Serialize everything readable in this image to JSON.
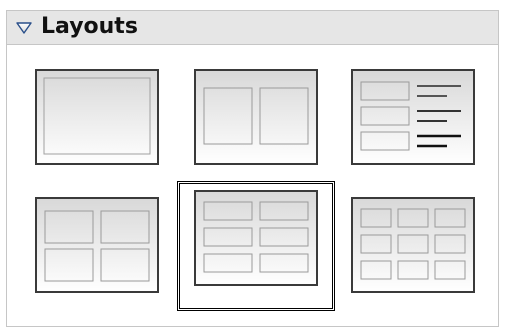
{
  "panel": {
    "title": "Layouts",
    "expanded": true,
    "toggle_icon": "triangle-down-icon"
  },
  "layouts": [
    {
      "id": "blank",
      "icon": "layout-blank-icon",
      "selected": false
    },
    {
      "id": "two-columns",
      "icon": "layout-two-columns-icon",
      "selected": false
    },
    {
      "id": "boxes-and-text",
      "icon": "layout-boxes-text-icon",
      "selected": false
    },
    {
      "id": "four-grid",
      "icon": "layout-four-grid-icon",
      "selected": false
    },
    {
      "id": "six-grid",
      "icon": "layout-six-grid-icon",
      "selected": true
    },
    {
      "id": "nine-grid",
      "icon": "layout-nine-grid-icon",
      "selected": false
    }
  ],
  "colors": {
    "header_bg": "#e6e6e6",
    "border": "#c6c6c6",
    "thumb_border": "#3a3a3a",
    "thumb_fill_top": "#dcdcdc",
    "thumb_fill_bottom": "#ffffff",
    "selection": "#000000"
  }
}
